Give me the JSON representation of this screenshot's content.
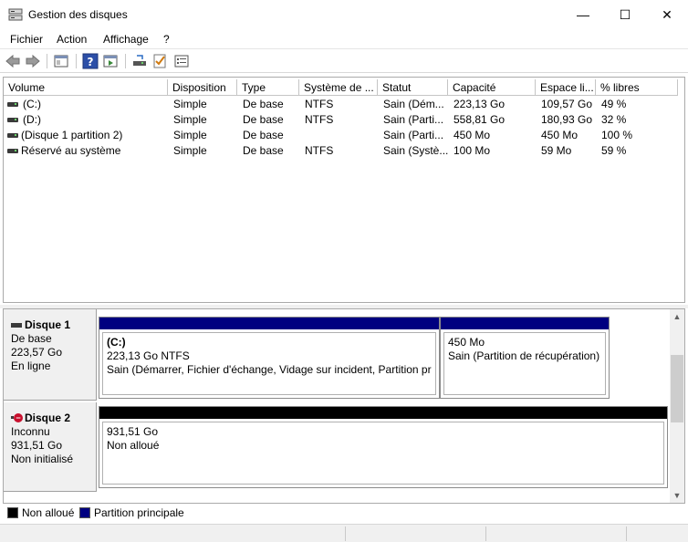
{
  "window": {
    "title": "Gestion des disques",
    "minimize": "—",
    "maximize": "☐",
    "close": "✕"
  },
  "menu": [
    "Fichier",
    "Action",
    "Affichage",
    "?"
  ],
  "toolbar": {
    "icons": [
      "back-icon",
      "forward-icon",
      "show-hide-console-tree-icon",
      "help-icon",
      "show-action-pane-icon",
      "connect-disk-icon",
      "check-icon",
      "properties-icon"
    ]
  },
  "table": {
    "headers": [
      "Volume",
      "Disposition",
      "Type",
      "Système de ...",
      "Statut",
      "Capacité",
      "Espace li...",
      "% libres"
    ],
    "rows": [
      [
        "(C:)",
        "Simple",
        "De base",
        "NTFS",
        "Sain (Dém...",
        "223,13 Go",
        "109,57 Go",
        "49 %"
      ],
      [
        "(D:)",
        "Simple",
        "De base",
        "NTFS",
        "Sain (Parti...",
        "558,81 Go",
        "180,93 Go",
        "32 %"
      ],
      [
        "(Disque 1 partition 2)",
        "Simple",
        "De base",
        "",
        "Sain (Parti...",
        "450 Mo",
        "450 Mo",
        "100 %"
      ],
      [
        "Réservé au système",
        "Simple",
        "De base",
        "NTFS",
        "Sain (Systè...",
        "100 Mo",
        "59 Mo",
        "59 %"
      ]
    ]
  },
  "disks": [
    {
      "name": "Disque 1",
      "type": "De base",
      "size": "223,57 Go",
      "state": "En ligne",
      "partitions": [
        {
          "title": "(C:)",
          "line1": "223,13 Go NTFS",
          "line2": "Sain (Démarrer, Fichier d'échange, Vidage sur incident, Partition prin",
          "color": "#000080"
        },
        {
          "title": "",
          "line1": "450 Mo",
          "line2": "Sain (Partition de récupération)",
          "color": "#000080"
        }
      ]
    },
    {
      "name": "Disque 2",
      "type": "Inconnu",
      "size": "931,51 Go",
      "state": "Non initialisé",
      "partitions": [
        {
          "title": "",
          "line1": "931,51 Go",
          "line2": "Non alloué",
          "color": "#000000"
        }
      ]
    }
  ],
  "legend": [
    {
      "label": "Non alloué",
      "color": "#000000"
    },
    {
      "label": "Partition principale",
      "color": "#000080"
    }
  ],
  "scroll": {
    "up": "▲",
    "down": "▼"
  }
}
